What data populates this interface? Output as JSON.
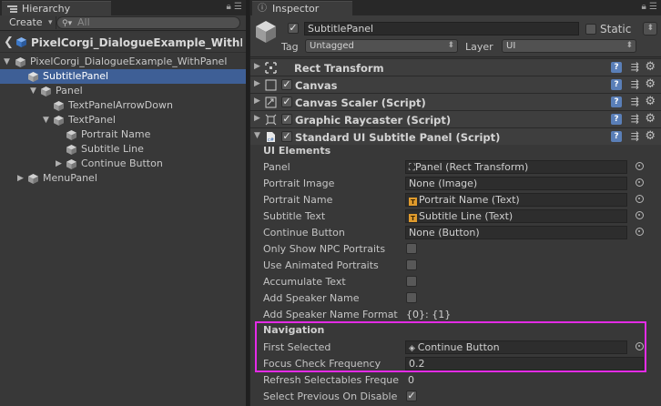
{
  "hierarchy": {
    "tab_label": "Hierarchy",
    "create_label": "Create",
    "search_placeholder": "All",
    "scene_title": "PixelCorgi_DialogueExample_WithP",
    "items": [
      {
        "label": "PixelCorgi_DialogueExample_WithPanel",
        "expanded": true
      },
      {
        "label": "SubtitlePanel",
        "selected": true
      },
      {
        "label": "Panel",
        "expanded": true
      },
      {
        "label": "TextPanelArrowDown"
      },
      {
        "label": "TextPanel",
        "expanded": true
      },
      {
        "label": "Portrait Name"
      },
      {
        "label": "Subtitle Line"
      },
      {
        "label": "Continue Button",
        "expanded": false
      },
      {
        "label": "MenuPanel",
        "expanded": false
      }
    ]
  },
  "inspector": {
    "tab_label": "Inspector",
    "object_name": "SubtitlePanel",
    "static_label": "Static",
    "tag_label": "Tag",
    "tag_value": "Untagged",
    "layer_label": "Layer",
    "layer_value": "UI",
    "components": [
      {
        "title": "Rect Transform",
        "icon": "rect-transform-icon",
        "has_checkbox": false
      },
      {
        "title": "Canvas",
        "icon": "canvas-icon",
        "has_checkbox": true
      },
      {
        "title": "Canvas Scaler (Script)",
        "icon": "script-icon",
        "has_checkbox": true
      },
      {
        "title": "Graphic Raycaster (Script)",
        "icon": "raycaster-icon",
        "has_checkbox": true
      },
      {
        "title": "Standard UI Subtitle Panel (Script)",
        "icon": "script-icon",
        "has_checkbox": true,
        "expanded": true
      }
    ],
    "sections": {
      "ui_elements": "UI Elements",
      "navigation": "Navigation"
    },
    "properties": {
      "panel": {
        "label": "Panel",
        "value": "Panel (Rect Transform)"
      },
      "portrait_image": {
        "label": "Portrait Image",
        "value": "None (Image)"
      },
      "portrait_name": {
        "label": "Portrait Name",
        "value": "Portrait Name (Text)"
      },
      "subtitle_text": {
        "label": "Subtitle Text",
        "value": "Subtitle Line (Text)"
      },
      "continue_button": {
        "label": "Continue Button",
        "value": "None (Button)"
      },
      "only_show_npc": {
        "label": "Only Show NPC Portraits"
      },
      "use_animated": {
        "label": "Use Animated Portraits"
      },
      "accumulate": {
        "label": "Accumulate Text"
      },
      "add_speaker": {
        "label": "Add Speaker Name"
      },
      "speaker_format": {
        "label": "Add Speaker Name Format",
        "value": "{0}: {1}"
      },
      "first_selected": {
        "label": "First Selected",
        "value": "Continue Button"
      },
      "focus_freq": {
        "label": "Focus Check Frequency",
        "value": "0.2"
      },
      "refresh_freq": {
        "label": "Refresh Selectables Freque",
        "value": "0"
      },
      "select_previous": {
        "label": "Select Previous On Disable",
        "checked": true
      }
    }
  },
  "colors": {
    "selection": "#3e5f96",
    "highlight_box": "#e42be6",
    "panel_bg": "#383838"
  }
}
